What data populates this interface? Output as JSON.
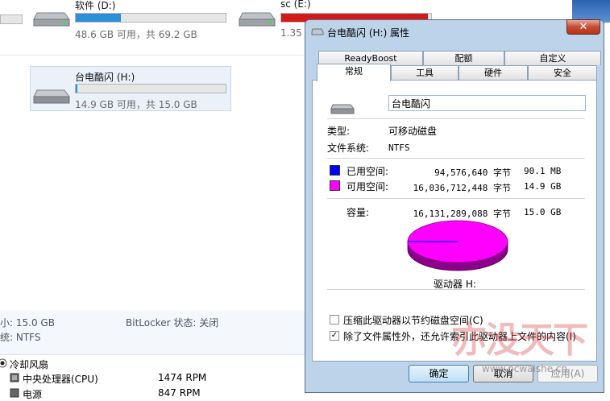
{
  "explorer": {
    "drives": [
      {
        "name": "软件 (D:)",
        "space": "48.6 GB 可用，共 69.2 GB",
        "fill": 0.3,
        "color": "#2a8fd6"
      },
      {
        "name": "sc (E:)",
        "space": "1.35",
        "fill": 0.98,
        "color": "#d11a1a"
      },
      {
        "name": "台电酷闪 (H:)",
        "space": "14.9 GB 可用，共 15.0 GB",
        "fill": 0.01,
        "color": "#2a8fd6"
      }
    ],
    "details": {
      "size": "小: 15.0 GB",
      "filesystem": "统: NTFS",
      "bitlocker": "BitLocker 状态: 关闭"
    },
    "sensors": {
      "section": "冷却风扇",
      "cpu_label": "中央处理器(CPU)",
      "cpu_value": "1474 RPM",
      "power_label": "电源",
      "power_value": "847 RPM"
    }
  },
  "dialog": {
    "title": "台电酷闪 (H:) 属性",
    "close_glyph": "✕",
    "tabs_row1": [
      "ReadyBoost",
      "配额",
      "自定义"
    ],
    "tabs_row2": [
      "常规",
      "工具",
      "硬件",
      "安全"
    ],
    "drive_label_value": "台电酷闪",
    "type_label": "类型:",
    "type_value": "可移动磁盘",
    "fs_label": "文件系统:",
    "fs_value": "NTFS",
    "used": {
      "label": "已用空间:",
      "bytes": "94,576,640 字节",
      "size": "90.1 MB",
      "color": "#0000ff"
    },
    "free": {
      "label": "可用空间:",
      "bytes": "16,036,712,448 字节",
      "size": "14.9 GB",
      "color": "#ff00ff"
    },
    "capacity": {
      "label": "容量:",
      "bytes": "16,131,289,088 字节",
      "size": "15.0 GB"
    },
    "drive_caption": "驱动器 H:",
    "used_fraction": 0.006,
    "compress_label": "压缩此驱动器以节约磁盘空间(C)",
    "compress_checked": false,
    "index_label": "除了文件属性外，还允许索引此驱动器上文件的内容(I)",
    "index_checked": true,
    "buttons": {
      "ok": "确定",
      "cancel": "取消",
      "apply": "应用(A)"
    }
  },
  "watermark": {
    "text": "亦没天下",
    "url": "www.pcwaishe.cn"
  }
}
